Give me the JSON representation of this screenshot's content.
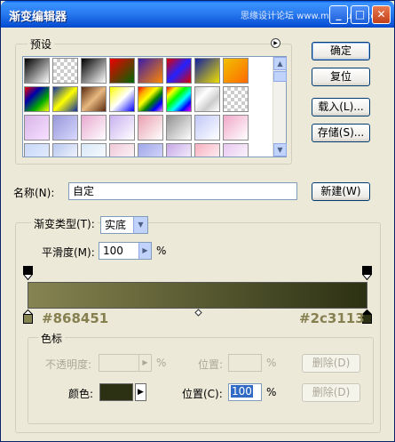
{
  "window": {
    "title": "渐变编辑器",
    "watermark": "思缘设计论坛 www.missyuan.com",
    "controls": {
      "minimize": "_",
      "maximize": "□",
      "close": "✕"
    }
  },
  "presets": {
    "label": "预设",
    "menu_icon": "triangle-right-icon",
    "swatches": [
      "linear-gradient(135deg,#000,#fff)",
      "repeating-conic-gradient(#ccc 0 25%, #fff 0 50%) 0 0/8px 8px",
      "linear-gradient(135deg,#000,#fff)",
      "linear-gradient(135deg,#e00,#060)",
      "linear-gradient(135deg,#3a1caa,#f80)",
      "linear-gradient(135deg,#d00,#22f,#d00)",
      "linear-gradient(135deg,#1020a0,#f0e000)",
      "linear-gradient(135deg,#f0c000,#ff6a00)",
      "linear-gradient(135deg,#e00,#00a,#0a0,#ff0)",
      "linear-gradient(135deg,#1030a0,#ff0,#1030a0)",
      "linear-gradient(135deg,#5a2a10,#e8b880,#5a2a10)",
      "linear-gradient(135deg,#ff0,#fff 50%,#00f)",
      "linear-gradient(135deg,red,orange,yellow,green,blue,violet)",
      "linear-gradient(135deg,red,yellow,lime,cyan,blue,magenta)",
      "linear-gradient(135deg,#ccc,#fff,#ccc,#fff)",
      "repeating-conic-gradient(#ccc 0 25%, #fff 0 50%) 0 0/8px 8px",
      "linear-gradient(135deg,#d8b4e8,#f8e0ff)",
      "linear-gradient(135deg,#9898d8,#d8d8ff)",
      "linear-gradient(135deg,#e8a8d0,#fff)",
      "linear-gradient(135deg,#c8b0f0,#fff)",
      "linear-gradient(135deg,#e8a0b0,#fff)",
      "linear-gradient(135deg,#909090,#fff)",
      "linear-gradient(135deg,#c0c8f8,#fff)",
      "linear-gradient(135deg,#f0a8c8,#fff)",
      "linear-gradient(135deg,#c8d8f8,#e8f0ff)",
      "linear-gradient(135deg,#b8c8f0,#fff)",
      "linear-gradient(135deg,#d8e8f8,#fff)",
      "linear-gradient(135deg,#f0c8d8,#fff)",
      "linear-gradient(135deg,#a0a8e8,#e0e0ff)",
      "linear-gradient(135deg,#c8a8e8,#fff)",
      "linear-gradient(135deg,#f8b0c0,#fff)",
      "linear-gradient(135deg,#e8c8f0,#fff)"
    ]
  },
  "buttons": {
    "ok": "确定",
    "reset": "复位",
    "load": "载入(L)...",
    "save": "存储(S)...",
    "new": "新建(W)"
  },
  "name": {
    "label": "名称(N):",
    "value": "自定"
  },
  "gradient_type": {
    "label": "渐变类型(T):",
    "value": "实底"
  },
  "smoothness": {
    "label": "平滑度(M):",
    "value": "100",
    "unit": "%"
  },
  "gradient": {
    "start_color": "#868451",
    "end_color": "#2c3113",
    "start_label": "#868451",
    "end_label": "#2c3113"
  },
  "stops": {
    "group_label": "色标",
    "opacity_label": "不透明度:",
    "opacity_unit": "%",
    "opacity_pos_label": "位置:",
    "opacity_pos_unit": "%",
    "delete_label_1": "删除(D)",
    "color_label": "颜色:",
    "color_value": "#2c3113",
    "color_pos_label": "位置(C):",
    "color_pos_value": "100",
    "color_pos_unit": "%",
    "delete_label_2": "删除(D)"
  }
}
